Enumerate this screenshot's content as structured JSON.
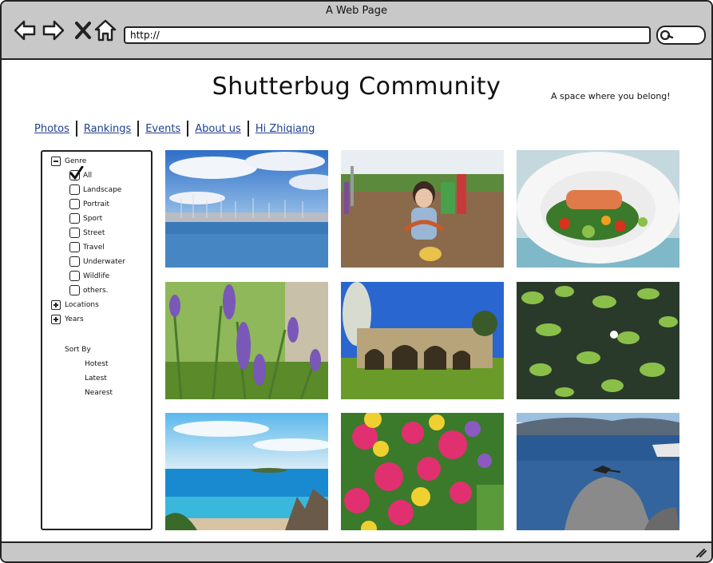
{
  "window": {
    "title": "A Web Page"
  },
  "browser": {
    "url": "http://",
    "icons": [
      "back-arrow-icon",
      "forward-arrow-icon",
      "close-icon",
      "home-icon",
      "search-icon"
    ]
  },
  "site": {
    "title": "Shutterbug Community",
    "tagline": "A space where you belong!"
  },
  "nav": {
    "links": [
      "Photos",
      "Rankings",
      "Events",
      "About us",
      "Hi Zhiqiang"
    ]
  },
  "filters": {
    "genre": {
      "label": "Genre",
      "expanded": true,
      "options": [
        {
          "label": "All",
          "checked": true
        },
        {
          "label": "Landscape",
          "checked": false
        },
        {
          "label": "Portrait",
          "checked": false
        },
        {
          "label": "Sport",
          "checked": false
        },
        {
          "label": "Street",
          "checked": false
        },
        {
          "label": "Travel",
          "checked": false
        },
        {
          "label": "Underwater",
          "checked": false
        },
        {
          "label": "Wildlife",
          "checked": false
        },
        {
          "label": "others.",
          "checked": false
        }
      ]
    },
    "locations": {
      "label": "Locations",
      "expanded": false
    },
    "years": {
      "label": "Years",
      "expanded": false
    }
  },
  "sort": {
    "label": "Sort By",
    "options": [
      "Hotest",
      "Latest",
      "Nearest"
    ]
  },
  "photos": [
    {
      "subject": "marina"
    },
    {
      "subject": "child-playground"
    },
    {
      "subject": "salmon-dish"
    },
    {
      "subject": "lavender"
    },
    {
      "subject": "stone-bridge"
    },
    {
      "subject": "lily-pond"
    },
    {
      "subject": "beach"
    },
    {
      "subject": "petunias"
    },
    {
      "subject": "bird-on-rock"
    }
  ],
  "colors": {
    "chrome": "#c8c8c8",
    "link": "#1f3f8f",
    "border": "#222222"
  }
}
